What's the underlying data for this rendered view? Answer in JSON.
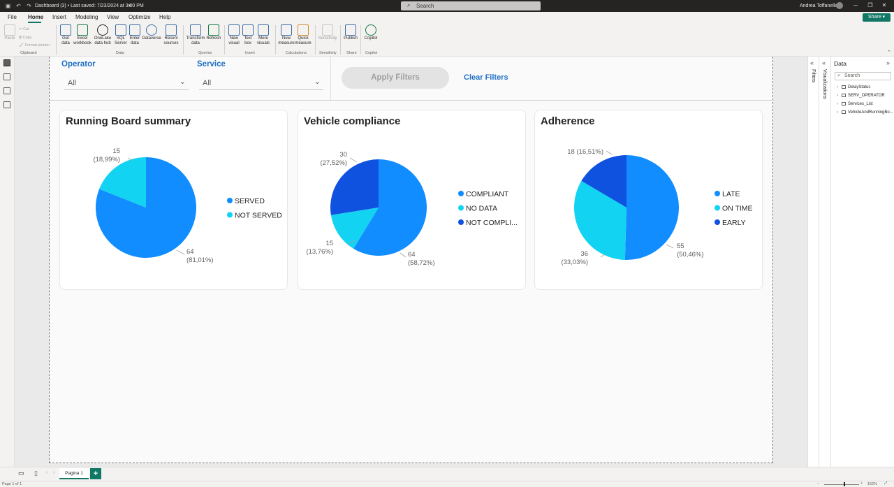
{
  "titlebar": {
    "title": "Dashboard (3) • Last saved: 7/23/2024 at 3:00 PM",
    "search_placeholder": "Search",
    "user": "Andrea Toffanello"
  },
  "menu": {
    "items": [
      "File",
      "Home",
      "Insert",
      "Modeling",
      "View",
      "Optimize",
      "Help"
    ],
    "active": "Home",
    "share_label": "Share"
  },
  "ribbon": {
    "clipboard": {
      "paste": "Paste",
      "cut": "Cut",
      "copy": "Copy",
      "format_painter": "Format painter",
      "group": "Clipboard"
    },
    "data": {
      "get_data": "Get data",
      "excel": "Excel workbook",
      "onelake": "OneLake data hub",
      "sql": "SQL Server",
      "enter": "Enter data",
      "dataverse": "Dataverse",
      "recent": "Recent sources",
      "group": "Data"
    },
    "queries": {
      "transform": "Transform data",
      "refresh": "Refresh",
      "group": "Queries"
    },
    "insert": {
      "new_visual": "New visual",
      "text_box": "Text box",
      "more_visuals": "More visuals",
      "group": "Insert"
    },
    "calculations": {
      "new_measure": "New measure",
      "quick_measure": "Quick measure",
      "group": "Calculations"
    },
    "sensitivity": {
      "label": "Sensitivity",
      "group": "Sensitivity"
    },
    "share": {
      "publish": "Publish",
      "group": "Share"
    },
    "copilot": {
      "label": "Copilot",
      "group": "Copilot"
    }
  },
  "filters": {
    "operator_label": "Operator",
    "operator_value": "All",
    "service_label": "Service",
    "service_value": "All",
    "apply_label": "Apply Filters",
    "clear_label": "Clear Filters"
  },
  "charts": {
    "running_board": {
      "title": "Running Board summary",
      "labels": [
        {
          "count": "64",
          "pct": "(81,01%)"
        },
        {
          "count": "15",
          "pct": "(18,99%)"
        }
      ]
    },
    "vehicle_compliance": {
      "title": "Vehicle compliance",
      "labels": [
        {
          "count": "64",
          "pct": "(58,72%)"
        },
        {
          "count": "15",
          "pct": "(13,76%)"
        },
        {
          "count": "30",
          "pct": "(27,52%)"
        }
      ]
    },
    "adherence": {
      "title": "Adherence",
      "labels": [
        {
          "text": "55",
          "pct": "(50,46%)"
        },
        {
          "text": "36",
          "pct": "(33,03%)"
        },
        {
          "text": "18 (16,51%)"
        }
      ]
    }
  },
  "chart_data": [
    {
      "type": "pie",
      "title": "Running Board summary",
      "categories": [
        "SERVED",
        "NOT SERVED"
      ],
      "values": [
        64,
        15
      ],
      "percentages": [
        "81,01%",
        "18,99%"
      ],
      "colors": [
        "#118dff",
        "#12d3f2"
      ],
      "legend": "right"
    },
    {
      "type": "pie",
      "title": "Vehicle compliance",
      "categories": [
        "COMPLIANT",
        "NO DATA",
        "NOT COMPLI..."
      ],
      "values": [
        64,
        15,
        30
      ],
      "percentages": [
        "58,72%",
        "13,76%",
        "27,52%"
      ],
      "colors": [
        "#118dff",
        "#12d3f2",
        "#1052e0"
      ],
      "legend": "right"
    },
    {
      "type": "pie",
      "title": "Adherence",
      "categories": [
        "LATE",
        "ON TIME",
        "EARLY"
      ],
      "values": [
        55,
        36,
        18
      ],
      "percentages": [
        "50,46%",
        "33,03%",
        "16,51%"
      ],
      "colors": [
        "#118dff",
        "#12d3f2",
        "#1052e0"
      ],
      "legend": "right"
    }
  ],
  "data_pane": {
    "title": "Data",
    "search_placeholder": "Search",
    "tables": [
      "DelayStatus",
      "SERV_OPERATOR",
      "Services_List",
      "VehicleAndRunningBo..."
    ],
    "filters_tab": "Filters",
    "visualizations_tab": "Visualizations"
  },
  "pages": {
    "tab": "Pagina 1",
    "add": "+"
  },
  "status": {
    "page": "Page 1 of 1",
    "zoom": "162%"
  }
}
